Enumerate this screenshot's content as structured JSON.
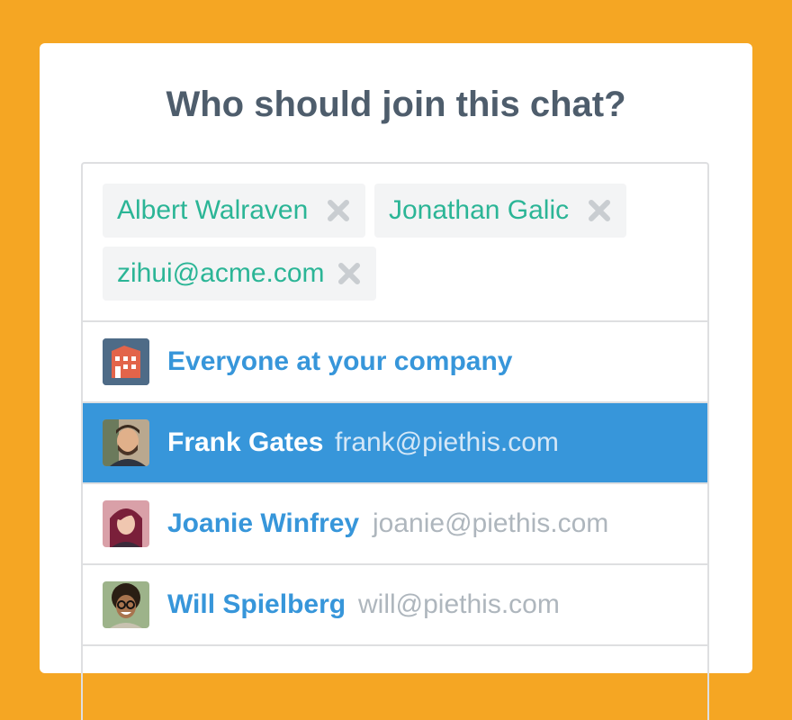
{
  "dialog": {
    "title": "Who should join this chat?"
  },
  "selected_chips": [
    {
      "label": "Albert Walraven",
      "remove_icon": "close-icon"
    },
    {
      "label": "Jonathan Galic",
      "remove_icon": "close-icon"
    },
    {
      "label": "zihui@acme.com",
      "remove_icon": "close-icon"
    }
  ],
  "suggestions": [
    {
      "name": "Everyone at your company",
      "email": "",
      "icon": "building-icon",
      "selected": false
    },
    {
      "name": "Frank Gates",
      "email": "frank@piethis.com",
      "icon": "avatar",
      "selected": true
    },
    {
      "name": "Joanie Winfrey",
      "email": "joanie@piethis.com",
      "icon": "avatar",
      "selected": false
    },
    {
      "name": "Will Spielberg",
      "email": "will@piethis.com",
      "icon": "avatar",
      "selected": false
    }
  ],
  "colors": {
    "background": "#F5A623",
    "accent": "#3796DA",
    "chip_text": "#2BB596",
    "title": "#4E5D6C"
  }
}
